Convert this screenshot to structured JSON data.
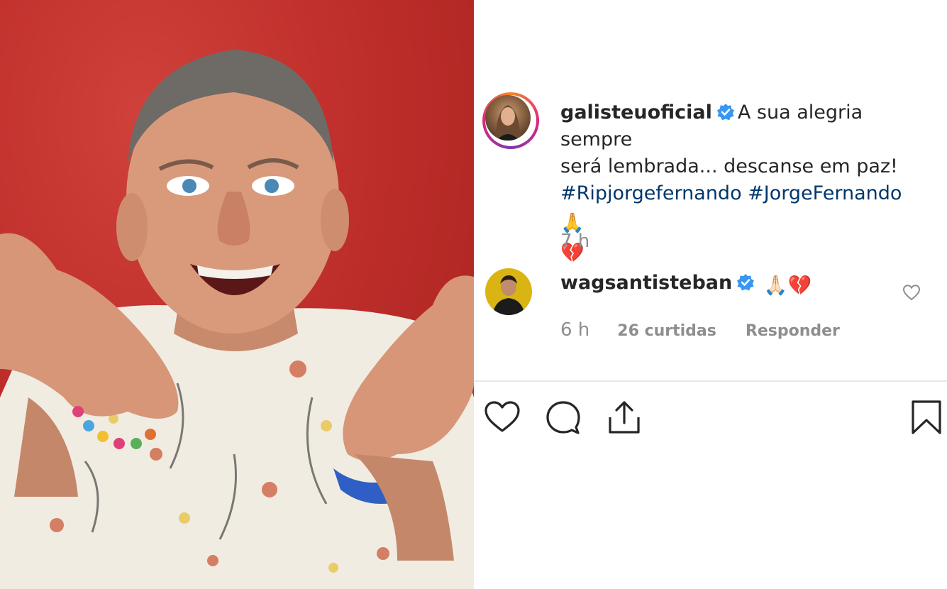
{
  "post": {
    "photo_alt": "photo",
    "author": {
      "username": "galisteuoficial",
      "verified": true
    },
    "caption": {
      "text_line1": "A sua alegria sempre",
      "text_line2": "será lembrada... descanse em paz!",
      "hashtag1": "#Ripjorgefernando",
      "hashtag2": "#JorgeFernando",
      "emoji_pray": "🙏",
      "emoji_heart": "💔"
    },
    "time_ago": "7 h"
  },
  "comment": {
    "username": "wagsantisteban",
    "verified": true,
    "emoji_pray": "🙏🏻",
    "emoji_heart": "💔",
    "time_ago": "6 h",
    "likes_label": "26 curtidas",
    "reply_label": "Responder"
  },
  "actions": {
    "icons": [
      "heart-icon",
      "comment-icon",
      "share-icon",
      "bookmark-icon"
    ]
  },
  "colors": {
    "verified_blue": "#3897f0",
    "hashtag_blue": "#00376b",
    "muted": "#8e8e8e",
    "photo_red": "#c1302c"
  }
}
